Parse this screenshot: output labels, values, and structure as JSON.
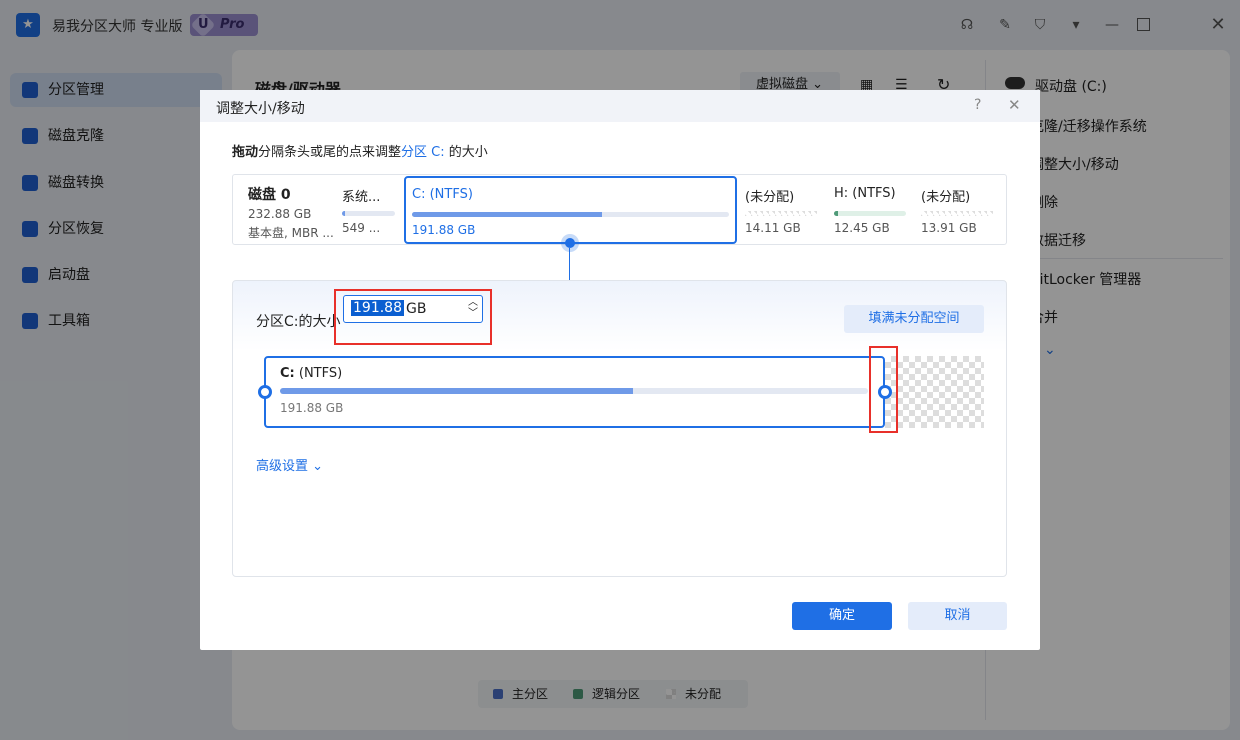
{
  "app": {
    "title": "易我分区大师 专业版",
    "badge": "Pro",
    "badge_letter": "U"
  },
  "window_controls": [
    "headset-icon",
    "feedback-icon",
    "shirt-icon",
    "download-icon",
    "minimize-icon",
    "maximize-icon",
    "close-icon"
  ],
  "sidebar": {
    "items": [
      {
        "label": "分区管理",
        "active": true
      },
      {
        "label": "磁盘克隆"
      },
      {
        "label": "磁盘转换"
      },
      {
        "label": "分区恢复"
      },
      {
        "label": "启动盘"
      },
      {
        "label": "工具箱"
      }
    ]
  },
  "main": {
    "title": "磁盘/驱动器",
    "dropdown": "虚拟磁盘"
  },
  "right_panel": {
    "drive": "驱动盘 (C:)",
    "actions": [
      "克隆/迁移操作系统",
      "调整大小/移动",
      "删除",
      "数据迁移"
    ],
    "actions2": [
      "BitLocker 管理器",
      "合并"
    ]
  },
  "legend": {
    "primary": "主分区",
    "logical": "逻辑分区",
    "unallocated": "未分配",
    "colors": {
      "primary": "#4a6fc7",
      "logical": "#4f9a78"
    }
  },
  "dialog": {
    "title": "调整大小/移动",
    "instruction": {
      "bold": "拖动",
      "text": "分隔条头或尾的点来调整",
      "highlight": "分区 C:",
      "tail": " 的大小"
    },
    "disk": {
      "name": "磁盘 0",
      "size": "232.88 GB",
      "type": "基本盘, MBR ..."
    },
    "partitions": [
      {
        "label": "系统...",
        "size": "549 ...",
        "usage": 0.05,
        "kind": "primary"
      },
      {
        "label": "C: (NTFS)",
        "size": "191.88 GB",
        "usage": 0.6,
        "kind": "primary",
        "selected": true
      },
      {
        "label": "(未分配)",
        "size": "14.11 GB",
        "kind": "unallocated"
      },
      {
        "label": "H: (NTFS)",
        "size": "12.45 GB",
        "usage": 0.05,
        "kind": "logical"
      },
      {
        "label": "(未分配)",
        "size": "13.91 GB",
        "kind": "unallocated"
      }
    ],
    "size_label": "分区C:的大小",
    "size_value": "191.88",
    "size_unit": "GB",
    "fill_button": "填满未分配空间",
    "partition_bar": {
      "drive": "C:",
      "fs": "(NTFS)",
      "size": "191.88 GB",
      "usage": 0.6
    },
    "advanced": "高级设置",
    "ok": "确定",
    "cancel": "取消"
  }
}
